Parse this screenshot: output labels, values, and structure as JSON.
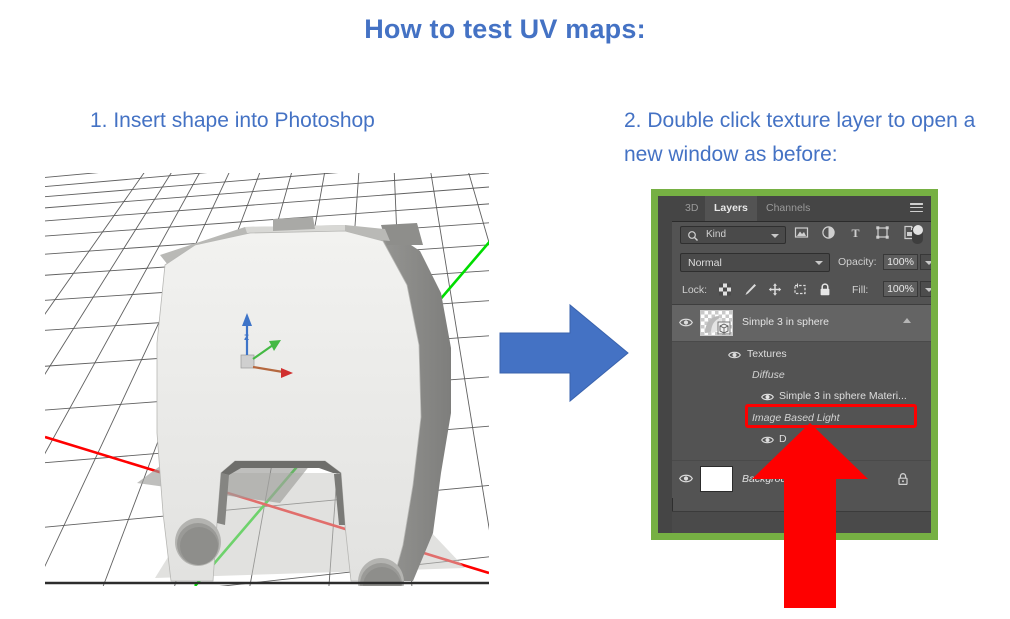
{
  "title": "How to test UV maps:",
  "steps": [
    {
      "number": "1.",
      "text": "1. Insert shape into Photoshop"
    },
    {
      "number": "2.",
      "text": "2. Double click texture layer to open a new window as before:"
    }
  ],
  "colors": {
    "heading": "#4472c4",
    "arrow_blue": "#4472c4",
    "annotation_red": "#fe0000",
    "panel_highlight_green": "#76b043",
    "panel_background": "#535353",
    "axis_x_red": "#ff0000",
    "axis_y_green": "#00dd00",
    "axis_z_blue": "#3e74c8",
    "model_gray": "#e8e8e6"
  },
  "viewport": {
    "name": "3d-viewport",
    "description": "3D perspective grid with gray bracket model",
    "axes": [
      {
        "name": "x-axis",
        "color": "#ff0000"
      },
      {
        "name": "y-axis",
        "color": "#00dd00"
      }
    ],
    "gizmo": {
      "name": "3d-axis-gizmo",
      "axes": [
        "z-blue",
        "y-green",
        "x-red"
      ]
    }
  },
  "flow_arrow": {
    "icon": "arrow-right-icon",
    "direction": "right"
  },
  "annotation": {
    "rect_icon": "red-highlight-rectangle",
    "arrow_icon": "arrow-up-icon",
    "points_to": "Simple 3 in sphere Materi..."
  },
  "photoshop": {
    "tabs": [
      {
        "label": "3D",
        "active": false
      },
      {
        "label": "Layers",
        "active": true
      },
      {
        "label": "Channels",
        "active": false
      }
    ],
    "menu_icon": "hamburger-menu-icon",
    "filter": {
      "search_icon": "search-icon",
      "kind_label": "Kind",
      "chevron_icon": "chevron-down-icon",
      "icons": [
        "pixel-layer-filter-icon",
        "adjustment-layer-filter-icon",
        "type-layer-filter-icon",
        "shape-layer-filter-icon",
        "smart-object-filter-icon"
      ],
      "toggle_icon": "filter-toggle-switch"
    },
    "blend": {
      "mode": "Normal",
      "mode_chevron": "chevron-down-icon",
      "opacity_label": "Opacity:",
      "opacity_value": "100%",
      "opacity_chevron": "chevron-down-icon"
    },
    "lock": {
      "label": "Lock:",
      "icons": [
        "lock-transparent-pixels-icon",
        "lock-image-pixels-icon",
        "lock-position-icon",
        "lock-artboard-icon",
        "lock-all-icon"
      ],
      "fill_label": "Fill:",
      "fill_value": "100%",
      "fill_chevron": "chevron-down-icon"
    },
    "layers": [
      {
        "name": "Simple 3 in sphere",
        "type": "3d-layer",
        "visible": true,
        "eye_icon": "eye-icon",
        "thumbnail": "3d-layer-thumbnail",
        "collapse_icon": "chevron-up-icon",
        "selected": true
      }
    ],
    "sublayers": [
      {
        "label": "Textures",
        "indent": 1,
        "eye_icon": "eye-icon",
        "italic": false,
        "highlighted": false
      },
      {
        "label": "Diffuse",
        "indent": 2,
        "eye_icon": null,
        "italic": true,
        "highlighted": false
      },
      {
        "label": "Simple 3 in sphere Materi...",
        "indent": 3,
        "eye_icon": "eye-icon",
        "italic": false,
        "highlighted": true
      },
      {
        "label": "Image Based Light",
        "indent": 2,
        "eye_icon": null,
        "italic": true,
        "highlighted": false
      },
      {
        "label": "D",
        "indent": 3,
        "eye_icon": "eye-icon",
        "italic": false,
        "highlighted": false
      }
    ],
    "background_layer": {
      "name": "Background",
      "eye_icon": "eye-icon",
      "thumbnail": "white-thumbnail",
      "lock_icon": "lock-icon",
      "visible": true
    }
  }
}
